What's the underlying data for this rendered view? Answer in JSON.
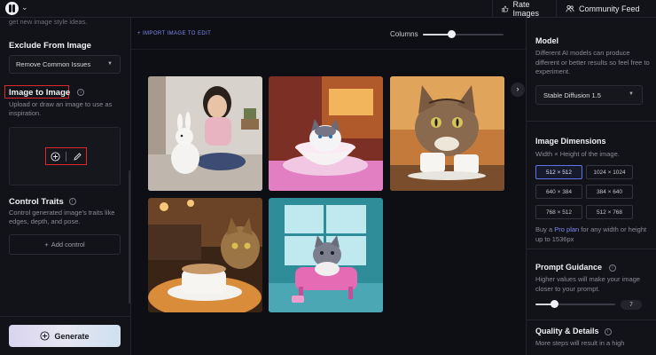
{
  "topbar": {
    "rate_images": "Rate Images",
    "community_feed": "Community Feed"
  },
  "sidebar": {
    "faded_text": "get new image style ideas.",
    "exclude": {
      "title": "Exclude From Image",
      "select_value": "Remove Common Issues"
    },
    "img2img": {
      "title": "Image to Image",
      "description": "Upload or draw an image to use as inspiration."
    },
    "control_traits": {
      "title": "Control Traits",
      "description": "Control generated image's traits like edges, depth, and pose.",
      "add_label": "Add control"
    },
    "generate_label": "Generate"
  },
  "main": {
    "import_link": "+ IMPORT IMAGE TO EDIT",
    "columns_label": "Columns",
    "columns_slider_fraction": 0.35,
    "images": [
      {
        "subject": "girl with white rabbit"
      },
      {
        "subject": "cat in teacup"
      },
      {
        "subject": "cat with coffee cups"
      },
      {
        "subject": "cat in cafe with coffee"
      },
      {
        "subject": "cat figure on pink chair"
      }
    ]
  },
  "right_panel": {
    "model": {
      "title": "Model",
      "description": "Different AI models can produce different or better results so feel free to experiment.",
      "selected": "Stable Diffusion 1.5"
    },
    "dimensions": {
      "title": "Image Dimensions",
      "description": "Width × Height of the image.",
      "options": [
        "512 × 512",
        "1024 × 1024",
        "640 × 384",
        "384 × 640",
        "768 × 512",
        "512 × 768"
      ],
      "active_index": 0,
      "upsell_prefix": "Buy a ",
      "upsell_link": "Pro plan",
      "upsell_suffix": " for any width or height up to 1536px"
    },
    "guidance": {
      "title": "Prompt Guidance",
      "description": "Higher values will make your image closer to your prompt.",
      "value": "7"
    },
    "quality": {
      "title": "Quality & Details",
      "description": "More steps will result in a high"
    }
  },
  "colors": {
    "accent": "#7d8cf2",
    "highlight": "#e0262b",
    "background": "#0d0e13"
  }
}
